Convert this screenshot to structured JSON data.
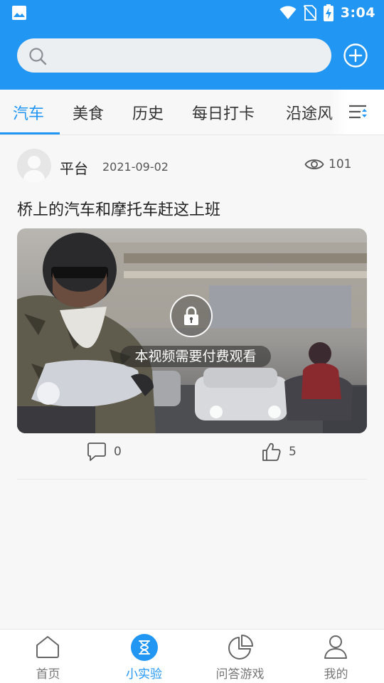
{
  "status_bar": {
    "time": "3:04"
  },
  "search": {
    "placeholder": ""
  },
  "tabs": [
    {
      "label": "汽车",
      "active": true
    },
    {
      "label": "美食"
    },
    {
      "label": "历史"
    },
    {
      "label": "每日打卡"
    },
    {
      "label": "沿途风"
    }
  ],
  "post": {
    "author": "平台",
    "date": "2021-09-02",
    "views": "101",
    "title": "桥上的汽车和摩托车赶这上班",
    "locked_label": "本视频需要付费观看",
    "comments": "0",
    "likes": "5"
  },
  "bottom_nav": [
    {
      "label": "首页"
    },
    {
      "label": "小实验",
      "active": true
    },
    {
      "label": "问答游戏"
    },
    {
      "label": "我的"
    }
  ],
  "colors": {
    "accent": "#2196f3",
    "text": "#222222",
    "muted": "#777777"
  }
}
